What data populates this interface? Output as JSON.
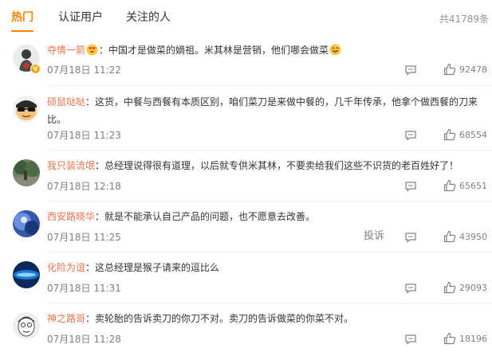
{
  "tabs": [
    {
      "label": "热门",
      "active": true
    },
    {
      "label": "认证用户",
      "active": false
    },
    {
      "label": "关注的人",
      "active": false
    }
  ],
  "total_count": "共41789条",
  "colors": {
    "accent": "#ff8200",
    "username": "#eb7350",
    "meta": "#808080",
    "text": "#333333"
  },
  "comments": [
    {
      "user": "夺情一箭",
      "text": "中国才是做菜的嫡祖。米其林是营销，他们哪会做菜",
      "time": "07月18日 11:22",
      "likes": "92478",
      "avatar": "person-icon",
      "verified": true,
      "emoji_after_name": "heart-eyes-emoji",
      "emoji_after_text": "laughing-emoji"
    },
    {
      "user": "硕鼠哒哒",
      "text": "这货，中餐与西餐有本质区别，咱们菜刀是来做中餐的，几千年传承，他拿个做西餐的刀来比。",
      "time": "07月18日 11:23",
      "likes": "68554",
      "avatar": "sunglasses-avatar"
    },
    {
      "user": "我只装流氓",
      "text": "总经理说得很有道理，以后就专供米其林，不要卖给我们这些不识货的老百姓好了！",
      "time": "07月18日 12:18",
      "likes": "65651",
      "avatar": "scenery-avatar"
    },
    {
      "user": "西安路晓华",
      "text": "就是不能承认自己产品的问题，也不愿意去改善。",
      "time": "07月18日 11:25",
      "likes": "43950",
      "avatar": "blue-abstract-avatar",
      "report_label": "投诉"
    },
    {
      "user": "化险为谊",
      "text": "这总经理是猴子请来的逗比么",
      "time": "07月18日 11:31",
      "likes": "29093",
      "avatar": "blue-orb-avatar"
    },
    {
      "user": "神之路哥",
      "text": "卖轮胎的告诉卖刀的你刀不对。卖刀的告诉做菜的你菜不对。",
      "time": "07月18日 11:28",
      "likes": "18196",
      "avatar": "sketch-face-avatar"
    }
  ]
}
